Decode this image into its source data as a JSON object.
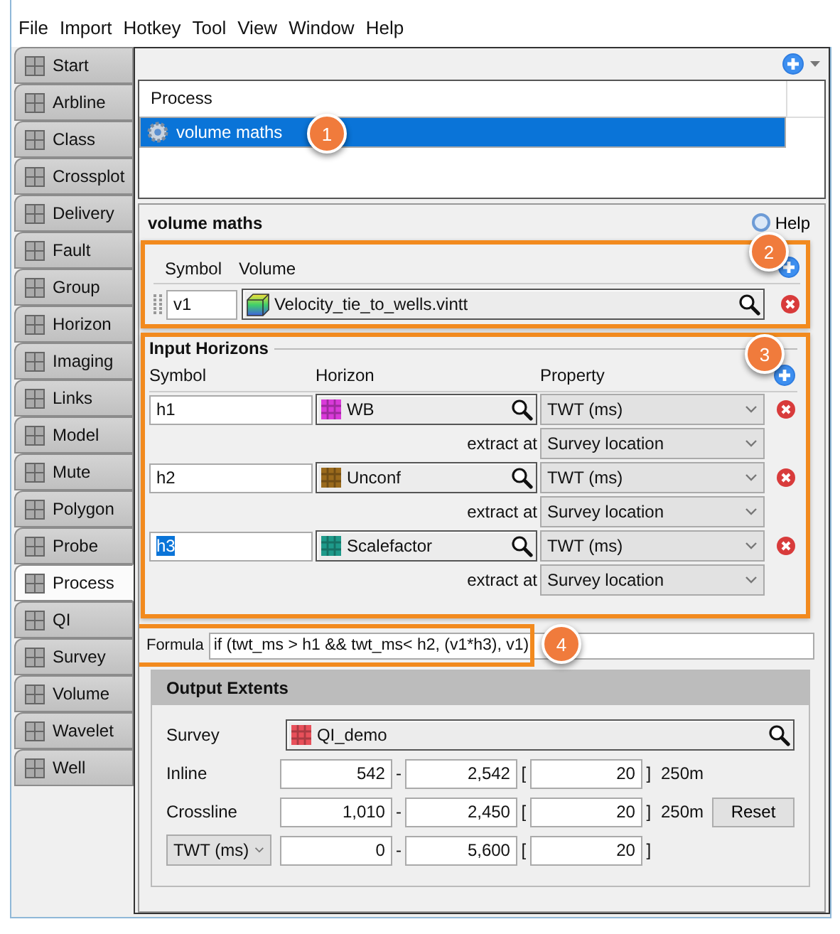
{
  "menu": [
    "File",
    "Import",
    "Hotkey",
    "Tool",
    "View",
    "Window",
    "Help"
  ],
  "sidebar": {
    "tabs": [
      {
        "label": "Start",
        "selected": false
      },
      {
        "label": "Arbline",
        "selected": false
      },
      {
        "label": "Class",
        "selected": false
      },
      {
        "label": "Crossplot",
        "selected": false
      },
      {
        "label": "Delivery",
        "selected": false
      },
      {
        "label": "Fault",
        "selected": false
      },
      {
        "label": "Group",
        "selected": false
      },
      {
        "label": "Horizon",
        "selected": false
      },
      {
        "label": "Imaging",
        "selected": false
      },
      {
        "label": "Links",
        "selected": false
      },
      {
        "label": "Model",
        "selected": false
      },
      {
        "label": "Mute",
        "selected": false
      },
      {
        "label": "Polygon",
        "selected": false
      },
      {
        "label": "Probe",
        "selected": false
      },
      {
        "label": "Process",
        "selected": true
      },
      {
        "label": "QI",
        "selected": false
      },
      {
        "label": "Survey",
        "selected": false
      },
      {
        "label": "Volume",
        "selected": false
      },
      {
        "label": "Wavelet",
        "selected": false
      },
      {
        "label": "Well",
        "selected": false
      }
    ]
  },
  "process_list": {
    "header": "Process",
    "callout": "1",
    "items": [
      {
        "label": "volume maths",
        "selected": true
      }
    ]
  },
  "editor": {
    "title": "volume maths",
    "help": "Help",
    "volumes": {
      "callout": "2",
      "columns": [
        "Symbol",
        "Volume"
      ],
      "rows": [
        {
          "symbol": "v1",
          "volume": "Velocity_tie_to_wells.vintt"
        }
      ]
    },
    "input_horizons": {
      "title": "Input Horizons",
      "callout": "3",
      "columns": [
        "Symbol",
        "Horizon",
        "Property"
      ],
      "rows": [
        {
          "symbol": "h1",
          "symbol_selected": false,
          "horizon": "WB",
          "color": "#d93ad9",
          "property": "TWT (ms)",
          "extract_label": "extract at",
          "extract": "Survey location"
        },
        {
          "symbol": "h2",
          "symbol_selected": false,
          "horizon": "Unconf",
          "color": "#9a6a1c",
          "property": "TWT (ms)",
          "extract_label": "extract at",
          "extract": "Survey location"
        },
        {
          "symbol": "h3",
          "symbol_selected": true,
          "horizon": "Scalefactor",
          "color": "#1e9a8a",
          "property": "TWT (ms)",
          "extract_label": "extract at",
          "extract": "Survey location"
        }
      ]
    },
    "formula": {
      "label": "Formula",
      "value": "if (twt_ms > h1 && twt_ms< h2, (v1*h3), v1)",
      "callout": "4"
    },
    "output_extents": {
      "title": "Output Extents",
      "survey_label": "Survey",
      "survey": "QI_demo",
      "rows": [
        {
          "kind": "label",
          "label": "Inline",
          "from": "542",
          "to": "2,542",
          "step": "20",
          "separators": [
            "-",
            "[",
            "]"
          ],
          "unit": "250m"
        },
        {
          "kind": "label",
          "label": "Crossline",
          "from": "1,010",
          "to": "2,450",
          "step": "20",
          "separators": [
            "-",
            "[",
            "]"
          ],
          "unit": "250m",
          "button": "Reset"
        },
        {
          "kind": "dropdown",
          "label": "TWT (ms)",
          "from": "0",
          "to": "5,600",
          "step": "20",
          "separators": [
            "-",
            "[",
            "]"
          ]
        }
      ]
    }
  }
}
